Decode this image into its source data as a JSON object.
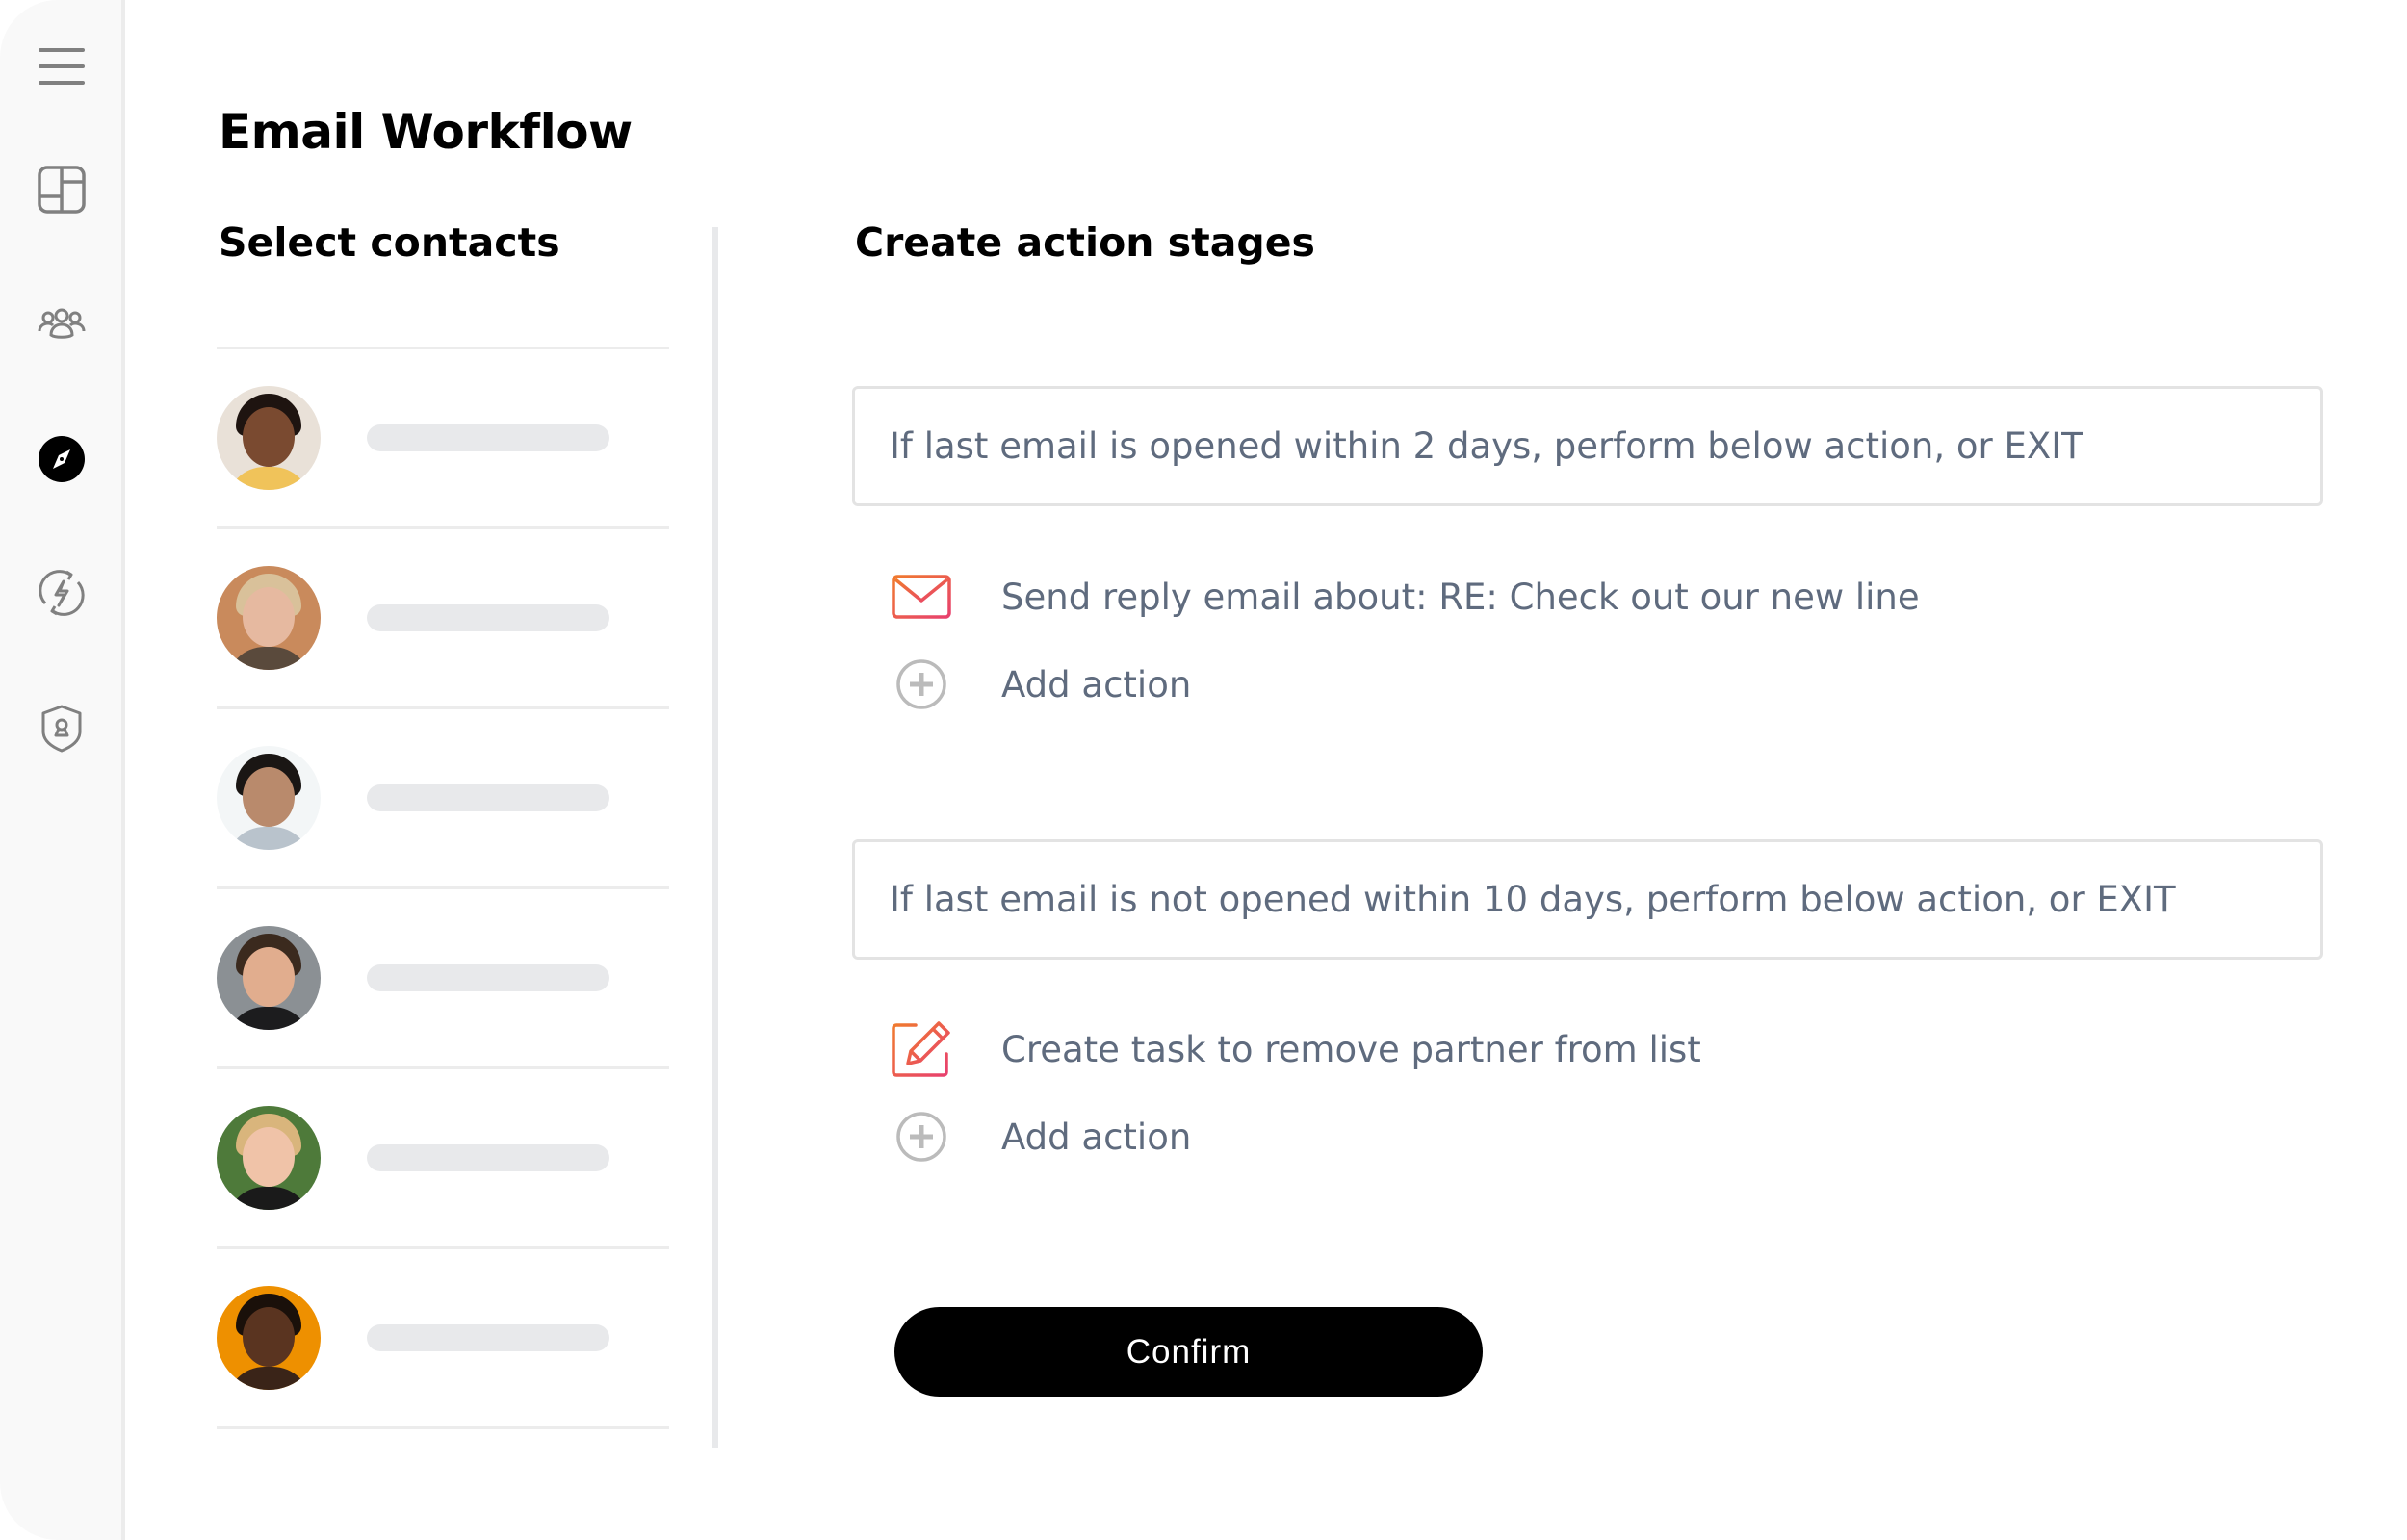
{
  "sidebar": {
    "items": [
      {
        "icon": "menu-icon",
        "active": false
      },
      {
        "icon": "dashboard-icon",
        "active": false
      },
      {
        "icon": "contacts-group-icon",
        "active": false
      },
      {
        "icon": "compass-icon",
        "active": true
      },
      {
        "icon": "automation-bolt-icon",
        "active": false
      },
      {
        "icon": "security-shield-icon",
        "active": false
      }
    ]
  },
  "header": {
    "title": "Email Workflow"
  },
  "contacts_panel": {
    "title": "Select contacts",
    "contacts": [
      {
        "avatar_bg": "#e9e1d8",
        "skin": "#7a4a30",
        "hair": "#1e1410",
        "clothing": "#f0c35a"
      },
      {
        "avatar_bg": "#c98a5c",
        "skin": "#e6b9a0",
        "hair": "#d9c19a",
        "clothing": "#5a4a3c"
      },
      {
        "avatar_bg": "#f3f6f7",
        "skin": "#b98a6c",
        "hair": "#1a1614",
        "clothing": "#b9c3cc"
      },
      {
        "avatar_bg": "#8b9094",
        "skin": "#e1ad8e",
        "hair": "#3b2a1e",
        "clothing": "#1c1c1e"
      },
      {
        "avatar_bg": "#4e7a3a",
        "skin": "#f0c3a8",
        "hair": "#d9b57c",
        "clothing": "#1a1a1a"
      },
      {
        "avatar_bg": "#ee9000",
        "skin": "#5a3420",
        "hair": "#1a100a",
        "clothing": "#3a2418"
      }
    ]
  },
  "stages_panel": {
    "title": "Create action stages",
    "stages": [
      {
        "condition": "If last email is opened within 2 days, perform below action, or EXIT",
        "action": {
          "icon": "mail-icon",
          "label": "Send reply email about: RE: Check out our new line"
        },
        "add_action_label": "Add action"
      },
      {
        "condition": "If last email is not opened within 10 days, perform below action, or EXIT",
        "action": {
          "icon": "edit-task-icon",
          "label": "Create task to remove partner from list"
        },
        "add_action_label": "Add action"
      }
    ],
    "confirm_label": "Confirm"
  },
  "colors": {
    "accent_gradient_start": "#f07a2e",
    "accent_gradient_end": "#e8406e",
    "text_muted": "#5f6b7e",
    "icon_gray": "#808080",
    "placeholder": "#e8e9eb",
    "primary_button": "#000000"
  }
}
